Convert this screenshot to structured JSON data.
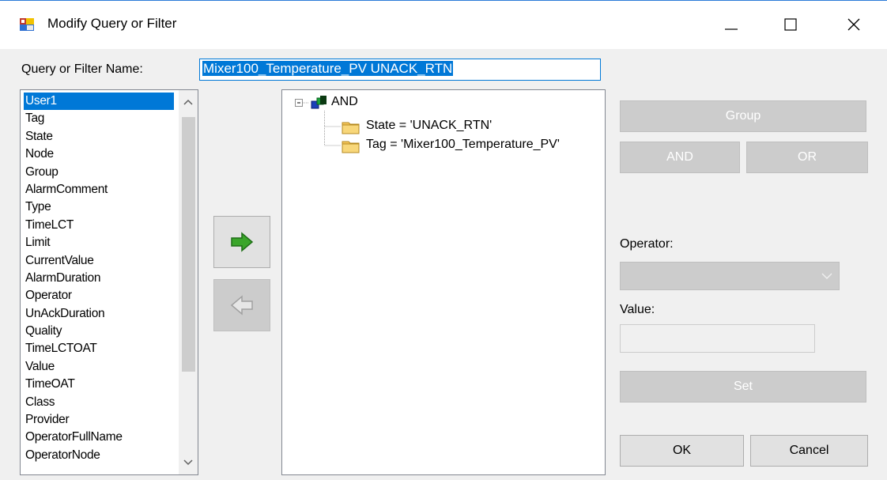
{
  "window": {
    "title": "Modify Query or Filter",
    "icons": {
      "app": "dialog-icon",
      "minimize": "minimize-icon",
      "maximize": "maximize-icon",
      "close": "close-icon"
    }
  },
  "form": {
    "name_label": "Query or Filter Name:",
    "name_value": "Mixer100_Temperature_PV UNACK_RTN"
  },
  "fields": {
    "items": [
      "User1",
      "Tag",
      "State",
      "Node",
      "Group",
      "AlarmComment",
      "Type",
      "TimeLCT",
      "Limit",
      "CurrentValue",
      "AlarmDuration",
      "Operator",
      "UnAckDuration",
      "Quality",
      "TimeLCTOAT",
      "Value",
      "TimeOAT",
      "Class",
      "Provider",
      "OperatorFullName",
      "OperatorNode"
    ],
    "selected": "User1"
  },
  "tree": {
    "root": "AND",
    "children": [
      "State = 'UNACK_RTN'",
      "Tag = 'Mixer100_Temperature_PV'"
    ]
  },
  "actions": {
    "group": "Group",
    "and": "AND",
    "or": "OR",
    "operator_label": "Operator:",
    "operator_value": "",
    "value_label": "Value:",
    "value_value": "",
    "set": "Set",
    "ok": "OK",
    "cancel": "Cancel"
  },
  "colors": {
    "accent": "#0078d7",
    "add_arrow": "#3aa52a",
    "disabled_button": "#cccccc"
  }
}
